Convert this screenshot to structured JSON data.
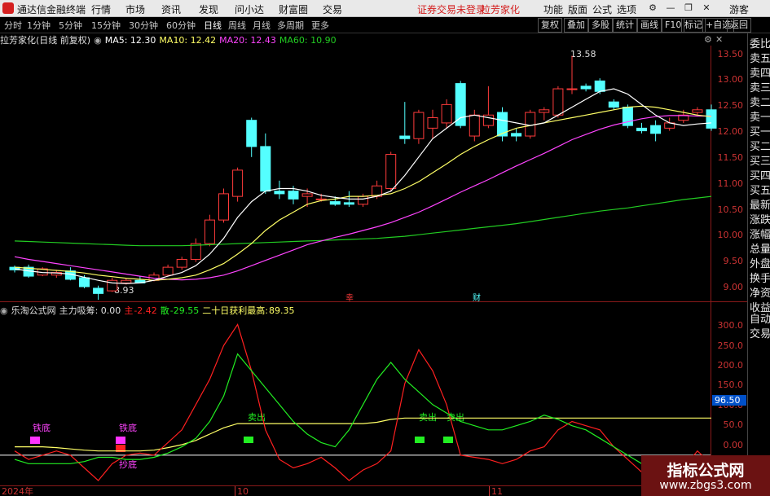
{
  "topbar": {
    "title": "通达信金融终端",
    "menu": [
      "行情",
      "市场",
      "资讯",
      "发现",
      "问小达",
      "财富圈",
      "交易"
    ],
    "warning": "证券交易未登录",
    "stock_name": "拉芳家化",
    "right_menu": [
      "功能",
      "版面",
      "公式",
      "选项"
    ],
    "guest": "游客"
  },
  "period_tabs": [
    "分时",
    "1分钟",
    "5分钟",
    "15分钟",
    "30分钟",
    "60分钟",
    "日线",
    "周线",
    "月线",
    "多周期",
    "更多"
  ],
  "active_tab": "日线",
  "toolbar_buttons": [
    "复权",
    "叠加",
    "多股",
    "统计",
    "画线",
    "F10",
    "标记",
    "+自选",
    "返回"
  ],
  "main_info": {
    "title": "拉芳家化(日线 前复权)",
    "ma5": "MA5: 12.30",
    "ma10": "MA10: 12.42",
    "ma20": "MA20: 12.43",
    "ma60": "MA60: 10.90"
  },
  "price_axis": [
    "13.50",
    "13.00",
    "12.50",
    "12.00",
    "11.50",
    "11.00",
    "10.50",
    "10.00",
    "9.50",
    "9.00"
  ],
  "annotations": {
    "high": "13.58",
    "low": "8.93",
    "mark1": "幸",
    "mark2": "财"
  },
  "sub_info": {
    "source": "乐淘公式网",
    "zhuli": "主力吸筹: 0.00",
    "zhu_label": "主",
    "zhu_value": "-2.42",
    "san_label": "散",
    "san_value": "-29.55",
    "best_label": "二十日获利最高:",
    "best_value": "89.35"
  },
  "sub_axis": [
    "300.0",
    "250.0",
    "200.0",
    "150.0",
    "100.0",
    "50.0",
    "0.00"
  ],
  "sub_current": "96.50",
  "signals": {
    "tiedi": "铁底",
    "maichu": "卖出",
    "baodi": "抄底"
  },
  "date_labels": [
    "2024年",
    "10",
    "11"
  ],
  "right_panel": [
    "委比",
    "卖五",
    "卖四",
    "卖三",
    "卖二",
    "卖一",
    "买一",
    "买二",
    "买三",
    "买四",
    "买五",
    "最新",
    "涨跌",
    "涨幅",
    "总量",
    "外盘",
    "换手",
    "净资",
    "收益",
    "自动",
    "交易"
  ],
  "watermark": {
    "title": "指标公式网",
    "url": "www.zbgs3.com"
  },
  "colors": {
    "up": "#ff3b3b",
    "down": "#54ffff",
    "ma5": "#ffffff",
    "ma10": "#ffff66",
    "ma20": "#ff44ff",
    "ma60": "#22cc22",
    "zhu": "#ff2020",
    "san": "#22ee22",
    "best": "#ffff66"
  },
  "chart_data": {
    "type": "candlestick",
    "ylim": [
      8.9,
      13.7
    ],
    "candles": [
      {
        "o": 9.55,
        "h": 9.58,
        "l": 9.45,
        "c": 9.5
      },
      {
        "o": 9.55,
        "h": 9.6,
        "l": 9.35,
        "c": 9.38
      },
      {
        "o": 9.4,
        "h": 9.55,
        "l": 9.38,
        "c": 9.52
      },
      {
        "o": 9.4,
        "h": 9.5,
        "l": 9.35,
        "c": 9.45
      },
      {
        "o": 9.48,
        "h": 9.55,
        "l": 9.3,
        "c": 9.32
      },
      {
        "o": 9.35,
        "h": 9.4,
        "l": 9.15,
        "c": 9.18
      },
      {
        "o": 9.15,
        "h": 9.2,
        "l": 8.93,
        "c": 9.05
      },
      {
        "o": 9.1,
        "h": 9.35,
        "l": 9.08,
        "c": 9.3
      },
      {
        "o": 9.25,
        "h": 9.35,
        "l": 9.22,
        "c": 9.3
      },
      {
        "o": 9.3,
        "h": 9.38,
        "l": 9.25,
        "c": 9.25
      },
      {
        "o": 9.3,
        "h": 9.45,
        "l": 9.28,
        "c": 9.4
      },
      {
        "o": 9.4,
        "h": 9.6,
        "l": 9.38,
        "c": 9.55
      },
      {
        "o": 9.55,
        "h": 9.75,
        "l": 9.5,
        "c": 9.7
      },
      {
        "o": 9.7,
        "h": 10.1,
        "l": 9.65,
        "c": 10.0
      },
      {
        "o": 10.0,
        "h": 10.55,
        "l": 9.95,
        "c": 10.45
      },
      {
        "o": 10.45,
        "h": 11.05,
        "l": 10.4,
        "c": 10.95
      },
      {
        "o": 10.9,
        "h": 11.45,
        "l": 10.8,
        "c": 11.4
      },
      {
        "o": 12.35,
        "h": 12.4,
        "l": 11.65,
        "c": 11.85
      },
      {
        "o": 11.85,
        "h": 12.1,
        "l": 10.95,
        "c": 11.0
      },
      {
        "o": 11.0,
        "h": 11.2,
        "l": 10.85,
        "c": 10.95
      },
      {
        "o": 11.0,
        "h": 11.1,
        "l": 10.75,
        "c": 10.85
      },
      {
        "o": 10.9,
        "h": 11.05,
        "l": 10.7,
        "c": 10.95
      },
      {
        "o": 10.85,
        "h": 10.95,
        "l": 10.8,
        "c": 10.85
      },
      {
        "o": 10.8,
        "h": 10.9,
        "l": 10.72,
        "c": 10.75
      },
      {
        "o": 10.78,
        "h": 11.0,
        "l": 10.7,
        "c": 10.75
      },
      {
        "o": 10.75,
        "h": 10.95,
        "l": 10.7,
        "c": 10.9
      },
      {
        "o": 10.9,
        "h": 11.2,
        "l": 10.85,
        "c": 11.1
      },
      {
        "o": 11.05,
        "h": 11.75,
        "l": 11.0,
        "c": 11.7
      },
      {
        "o": 12.05,
        "h": 12.7,
        "l": 11.9,
        "c": 12.0
      },
      {
        "o": 12.0,
        "h": 12.55,
        "l": 11.9,
        "c": 12.5
      },
      {
        "o": 12.2,
        "h": 12.55,
        "l": 12.0,
        "c": 12.4
      },
      {
        "o": 12.3,
        "h": 12.75,
        "l": 12.2,
        "c": 12.65
      },
      {
        "o": 13.05,
        "h": 13.1,
        "l": 12.2,
        "c": 12.25
      },
      {
        "o": 12.05,
        "h": 12.55,
        "l": 11.95,
        "c": 12.45
      },
      {
        "o": 12.25,
        "h": 13.0,
        "l": 12.2,
        "c": 12.45
      },
      {
        "o": 12.5,
        "h": 12.6,
        "l": 11.95,
        "c": 12.05
      },
      {
        "o": 12.1,
        "h": 12.2,
        "l": 11.95,
        "c": 12.05
      },
      {
        "o": 12.05,
        "h": 12.55,
        "l": 12.0,
        "c": 12.5
      },
      {
        "o": 12.5,
        "h": 12.6,
        "l": 12.35,
        "c": 12.55
      },
      {
        "o": 12.45,
        "h": 13.0,
        "l": 12.4,
        "c": 12.95
      },
      {
        "o": 12.95,
        "h": 13.58,
        "l": 12.85,
        "c": 12.95
      },
      {
        "o": 13.0,
        "h": 13.05,
        "l": 12.9,
        "c": 12.95
      },
      {
        "o": 13.1,
        "h": 13.15,
        "l": 12.85,
        "c": 12.9
      },
      {
        "o": 12.7,
        "h": 12.75,
        "l": 12.55,
        "c": 12.6
      },
      {
        "o": 12.6,
        "h": 12.65,
        "l": 12.2,
        "c": 12.25
      },
      {
        "o": 12.2,
        "h": 12.3,
        "l": 12.1,
        "c": 12.15
      },
      {
        "o": 12.25,
        "h": 12.35,
        "l": 11.95,
        "c": 12.1
      },
      {
        "o": 12.2,
        "h": 12.4,
        "l": 12.15,
        "c": 12.3
      },
      {
        "o": 12.35,
        "h": 12.55,
        "l": 12.3,
        "c": 12.45
      },
      {
        "o": 12.5,
        "h": 12.6,
        "l": 12.45,
        "c": 12.55
      },
      {
        "o": 12.55,
        "h": 12.65,
        "l": 12.15,
        "c": 12.2
      }
    ],
    "ma5": [
      9.52,
      9.48,
      9.45,
      9.44,
      9.42,
      9.36,
      9.3,
      9.25,
      9.24,
      9.25,
      9.3,
      9.38,
      9.45,
      9.58,
      9.8,
      10.1,
      10.5,
      10.8,
      11.0,
      11.05,
      11.05,
      11.0,
      10.92,
      10.88,
      10.85,
      10.85,
      10.9,
      11.0,
      11.3,
      11.65,
      12.0,
      12.2,
      12.4,
      12.45,
      12.4,
      12.35,
      12.3,
      12.25,
      12.3,
      12.45,
      12.6,
      12.75,
      12.9,
      12.95,
      12.85,
      12.65,
      12.45,
      12.3,
      12.25,
      12.28,
      12.3
    ],
    "ma10": [
      9.55,
      9.53,
      9.51,
      9.49,
      9.47,
      9.44,
      9.4,
      9.37,
      9.34,
      9.32,
      9.3,
      9.32,
      9.35,
      9.4,
      9.5,
      9.62,
      9.8,
      10.0,
      10.25,
      10.45,
      10.6,
      10.75,
      10.82,
      10.85,
      10.9,
      10.9,
      10.92,
      10.95,
      11.05,
      11.18,
      11.35,
      11.52,
      11.7,
      11.85,
      11.98,
      12.1,
      12.2,
      12.25,
      12.3,
      12.35,
      12.4,
      12.45,
      12.5,
      12.55,
      12.6,
      12.62,
      12.6,
      12.55,
      12.5,
      12.45,
      12.42
    ],
    "ma20": [
      9.75,
      9.7,
      9.66,
      9.62,
      9.58,
      9.54,
      9.5,
      9.46,
      9.42,
      9.38,
      9.34,
      9.32,
      9.31,
      9.32,
      9.35,
      9.4,
      9.48,
      9.58,
      9.68,
      9.78,
      9.88,
      9.98,
      10.05,
      10.12,
      10.18,
      10.25,
      10.32,
      10.4,
      10.5,
      10.6,
      10.72,
      10.85,
      10.98,
      11.1,
      11.22,
      11.35,
      11.48,
      11.6,
      11.72,
      11.85,
      11.98,
      12.08,
      12.18,
      12.26,
      12.32,
      12.38,
      12.42,
      12.44,
      12.44,
      12.43,
      12.43
    ],
    "ma60": [
      10.05,
      10.04,
      10.03,
      10.02,
      10.01,
      10.0,
      9.99,
      9.98,
      9.97,
      9.96,
      9.96,
      9.96,
      9.96,
      9.97,
      9.98,
      9.99,
      10.0,
      10.01,
      10.02,
      10.03,
      10.04,
      10.05,
      10.06,
      10.07,
      10.08,
      10.09,
      10.1,
      10.12,
      10.14,
      10.17,
      10.2,
      10.23,
      10.26,
      10.29,
      10.32,
      10.35,
      10.38,
      10.42,
      10.46,
      10.5,
      10.54,
      10.58,
      10.62,
      10.65,
      10.68,
      10.72,
      10.76,
      10.8,
      10.84,
      10.87,
      10.9
    ],
    "sub_ylim": [
      -60,
      330
    ],
    "zhu": [
      10,
      -10,
      0,
      10,
      0,
      -30,
      -60,
      -20,
      0,
      5,
      0,
      30,
      60,
      120,
      180,
      260,
      310,
      200,
      60,
      -10,
      -30,
      -20,
      -5,
      -30,
      -60,
      -35,
      -20,
      10,
      170,
      250,
      200,
      120,
      0,
      -5,
      -10,
      -20,
      -10,
      10,
      20,
      60,
      80,
      70,
      60,
      20,
      -10,
      -40,
      -55,
      -50,
      -30,
      10,
      -20
    ],
    "san": [
      -10,
      -20,
      -20,
      -20,
      -20,
      -15,
      -5,
      -5,
      -10,
      -10,
      -5,
      5,
      20,
      40,
      80,
      140,
      240,
      200,
      160,
      120,
      80,
      50,
      30,
      20,
      60,
      120,
      180,
      220,
      180,
      150,
      120,
      100,
      80,
      70,
      60,
      60,
      70,
      80,
      95,
      85,
      70,
      60,
      40,
      20,
      0,
      -20,
      -30,
      -25,
      -15,
      -10,
      -25
    ],
    "best": [
      20,
      20,
      20,
      18,
      15,
      12,
      10,
      10,
      10,
      10,
      12,
      18,
      25,
      35,
      50,
      65,
      75,
      75,
      75,
      75,
      75,
      75,
      75,
      75,
      75,
      75,
      78,
      85,
      88,
      88,
      88,
      88,
      88,
      88,
      88,
      88,
      88,
      88,
      88,
      88,
      88,
      88,
      88,
      88,
      88,
      88,
      88,
      88,
      88,
      88,
      88
    ]
  }
}
